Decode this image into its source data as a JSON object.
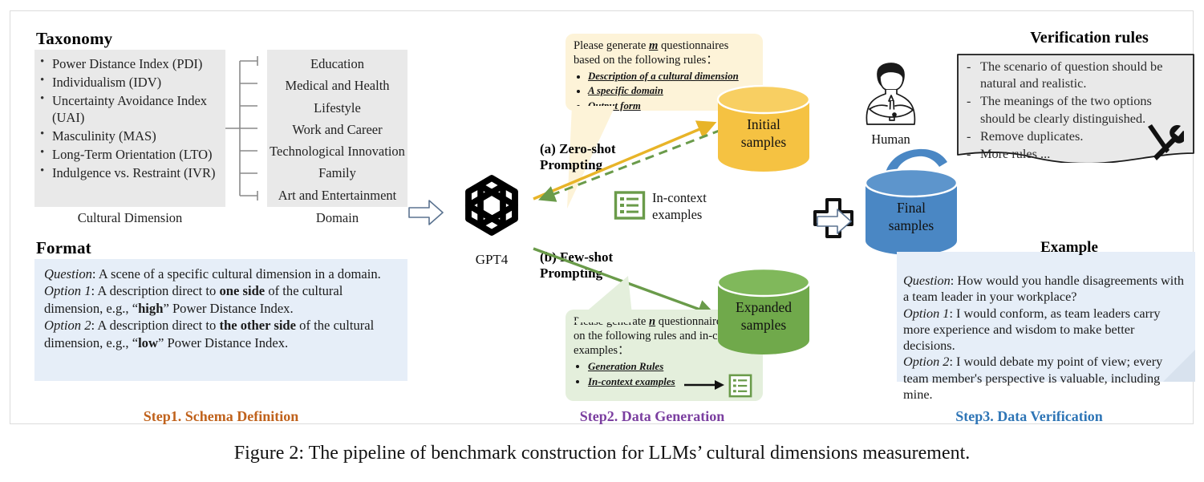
{
  "figure": {
    "caption": "Figure 2: The pipeline of benchmark construction for LLMs’ cultural dimensions measurement."
  },
  "step1": {
    "taxonomy_title": "Taxonomy",
    "cultural_dimension": {
      "label": "Cultural Dimension",
      "items": [
        "Power Distance Index (PDI)",
        "Individualism (IDV)",
        "Uncertainty Avoidance Index (UAI)",
        "Masculinity (MAS)",
        "Long-Term Orientation (LTO)",
        "Indulgence vs. Restraint (IVR)"
      ]
    },
    "domain": {
      "label": "Domain",
      "items": [
        "Education",
        "Medical and Health",
        "Lifestyle",
        "Work and Career",
        "Technological Innovation",
        "Family",
        "Art and Entertainment"
      ]
    },
    "format_title": "Format",
    "format": {
      "question_key": "Question",
      "question_text": ":  A scene of a specific cultural dimension in a domain.",
      "option1_key": "Option 1",
      "option1_a": ":  A description direct to ",
      "option1_bold": "one side",
      "option1_b": " of the cultural dimension,  e.g., “",
      "option1_bold2": "high",
      "option1_c": "”  Power Distance Index.",
      "option2_key": "Option 2",
      "option2_a": ":  A description direct to ",
      "option2_bold": "the other side",
      "option2_b": " of the cultural dimension,  e.g., “",
      "option2_bold2": "low",
      "option2_c": "”  Power Distance Index."
    },
    "step_label": "Step1. Schema Definition"
  },
  "step2": {
    "model_label": "GPT4",
    "zero_shot_title": "(a) Zero-shot Prompting",
    "few_shot_title": "(b) Few-shot Prompting",
    "zero_shot_prompt": {
      "line1_a": "Please generate ",
      "line1_var": "m",
      "line1_b": " questionnaires based on the following rules：",
      "bullets": [
        "Description of  a cultural dimension",
        "A specific domain",
        "Output  form"
      ]
    },
    "few_shot_prompt": {
      "line1_a": "Please generate ",
      "line1_var": "n",
      "line1_b": " questionnaires based on the following rules and in-context examples：",
      "bullets": [
        "Generation Rules",
        "In-context examples"
      ]
    },
    "incontext_label_line1": "In-context",
    "incontext_label_line2": "examples",
    "initial_samples_line1": "Initial",
    "initial_samples_line2": "samples",
    "expanded_samples_line1": "Expanded",
    "expanded_samples_line2": "samples",
    "step_label": "Step2. Data Generation"
  },
  "step3": {
    "human_label": "Human",
    "final_samples_line1": "Final",
    "final_samples_line2": "samples",
    "verification_title": "Verification rules",
    "verification_rules": [
      "The scenario of question should be natural and realistic.",
      "The meanings of the two options should be clearly distinguished.",
      "Remove duplicates.",
      "More rules ..."
    ],
    "example_title": "Example",
    "example": {
      "question_key": "Question",
      "question_text": ": How would you handle disagreements with a team leader in your workplace?",
      "option1_key": "Option 1",
      "option1_text": ":  I would conform, as team leaders carry more experience and wisdom to make better decisions.",
      "option2_key": "Option 2",
      "option2_text": ":  I would debate my point of view; every team member's perspective is valuable, including mine."
    },
    "step_label": "Step3. Data Verification"
  },
  "colors": {
    "step1_accent": "#c0621c",
    "step2_accent": "#7b3fa0",
    "step3_accent": "#2e75b6",
    "initial_samples": "#f5c242",
    "expanded_samples": "#70a94b",
    "final_samples": "#4a87c4",
    "gray_box": "#e9e9e9",
    "blue_box": "#e6eef8"
  }
}
